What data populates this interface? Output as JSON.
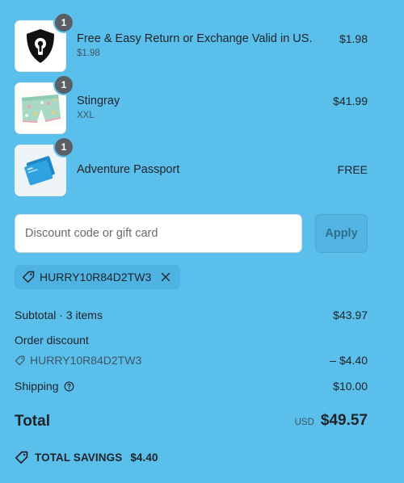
{
  "colors": {
    "background": "#5bbfec",
    "badge": "#5a5f66",
    "chip": "#4eb3e2",
    "apply_button": "#53b4e1"
  },
  "items": [
    {
      "title": "Free & Easy Return or Exchange Valid in US.",
      "subtitle": "$1.98",
      "price": "$1.98",
      "quantity": "1",
      "icon": "shield-keyhole-icon"
    },
    {
      "title": "Stingray",
      "subtitle": "XXL",
      "price": "$41.99",
      "quantity": "1",
      "icon": "shorts-image"
    },
    {
      "title": "Adventure Passport",
      "subtitle": "",
      "price": "FREE",
      "quantity": "1",
      "icon": "passport-image"
    }
  ],
  "discount": {
    "placeholder": "Discount code or gift card",
    "value": "",
    "apply_label": "Apply",
    "applied_code": "HURRY10R84D2TW3"
  },
  "summary": {
    "subtotal_label": "Subtotal · 3 items",
    "subtotal_value": "$43.97",
    "order_discount_label": "Order discount",
    "discount_code": "HURRY10R84D2TW3",
    "discount_value": "– $4.40",
    "shipping_label": "Shipping",
    "shipping_value": "$10.00"
  },
  "total": {
    "label": "Total",
    "currency": "USD",
    "amount": "$49.57"
  },
  "savings": {
    "label": "TOTAL SAVINGS",
    "amount": "$4.40"
  }
}
